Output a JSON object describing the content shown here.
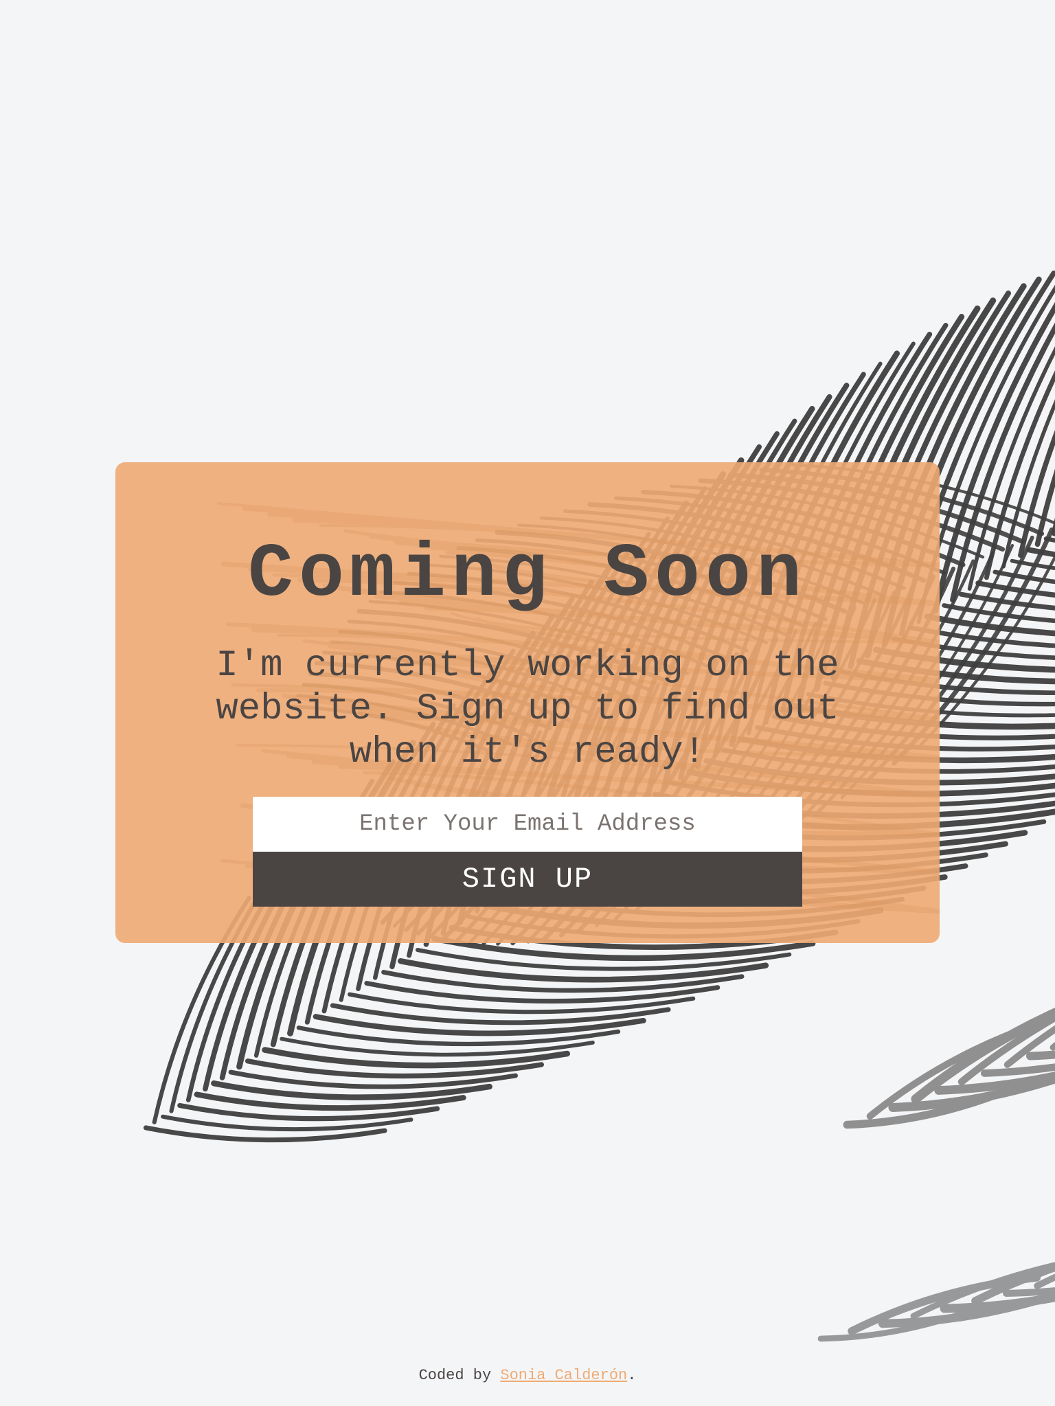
{
  "colors": {
    "background": "#f4f5f7",
    "card": "#f0aa73",
    "text": "#4a4543",
    "button": "#4a4543",
    "button_text": "#ffffff",
    "link": "#f0aa73",
    "leaf": "#3f3f3f"
  },
  "hero": {
    "title": "Coming Soon",
    "subtitle": "I'm currently working on the website. Sign up to find out when it's ready!"
  },
  "form": {
    "email_placeholder": "Enter Your Email Address",
    "email_value": "",
    "submit_label": "SIGN UP"
  },
  "footer": {
    "prefix": "Coded by ",
    "author_link": "Sonia Calderón",
    "suffix": "."
  }
}
